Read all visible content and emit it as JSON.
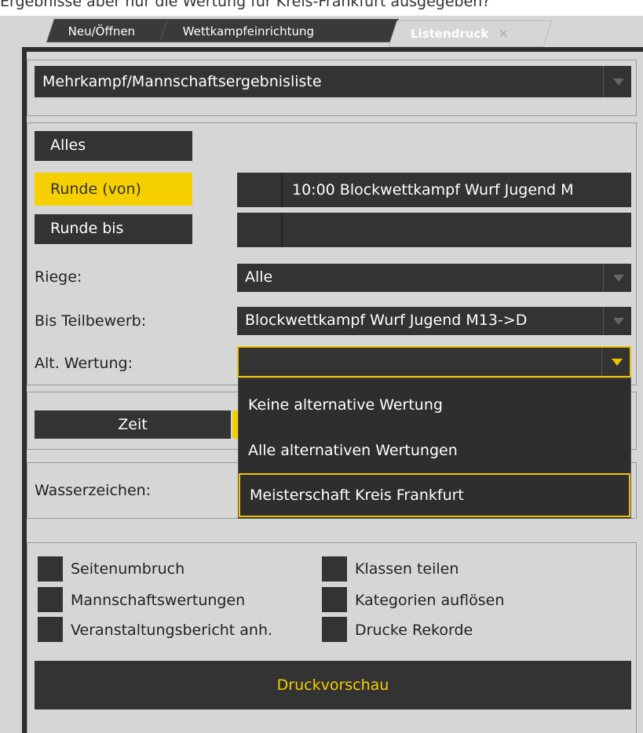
{
  "top_strip_text": "Ergebnisse aber nur die Wertung für Kreis-Frankfurt ausgegeben?",
  "tabs": [
    {
      "label": "Neu/Öffnen"
    },
    {
      "label": "Wettkampfeinrichtung"
    },
    {
      "label": "Listendruck",
      "close": "✕"
    }
  ],
  "list_type": {
    "value": "Mehrkampf/Mannschaftsergebnisliste"
  },
  "round": {
    "all_label": "Alles",
    "from_label": "Runde (von)",
    "from_value": "10:00 Blockwettkampf Wurf Jugend M",
    "to_label": "Runde bis",
    "to_value": ""
  },
  "riege": {
    "label": "Riege:",
    "value": "Alle"
  },
  "bis_teilbewerb": {
    "label": "Bis Teilbewerb:",
    "value": "Blockwettkampf Wurf Jugend M13->D"
  },
  "alt_wertung": {
    "label": "Alt. Wertung:",
    "value": ""
  },
  "time_button": {
    "label": "Zeit"
  },
  "watermark": {
    "label": "Wasserzeichen:"
  },
  "dropdown_options": [
    {
      "label": "Keine alternative Wertung"
    },
    {
      "label": "Alle alternativen Wertungen"
    },
    {
      "label": "Meisterschaft Kreis Frankfurt"
    }
  ],
  "options_left": [
    {
      "label": "Seitenumbruch"
    },
    {
      "label": "Mannschaftswertungen"
    },
    {
      "label": "Veranstaltungsbericht anh."
    }
  ],
  "options_right": [
    {
      "label": "Klassen teilen"
    },
    {
      "label": "Kategorien auflösen"
    },
    {
      "label": "Drucke Rekorde"
    }
  ],
  "preview_button": {
    "label": "Druckvorschau"
  },
  "colors": {
    "accent": "#f5cf00",
    "dark": "#333333",
    "panel": "#d6d6d6"
  }
}
